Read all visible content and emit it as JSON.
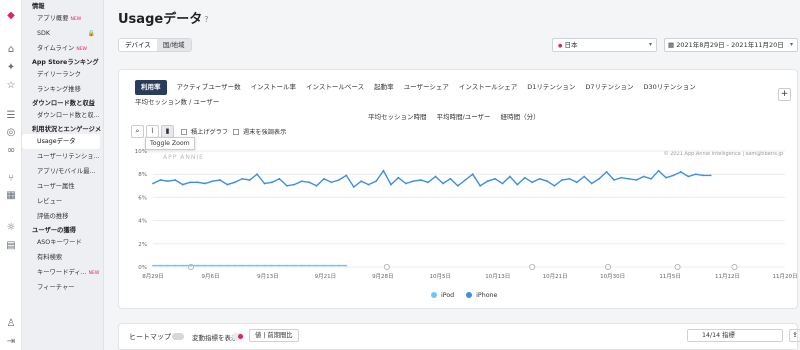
{
  "sidebar": {
    "groups": [
      {
        "heading": "情報",
        "items": [
          {
            "label": "アプリ概要",
            "badge": "NEW"
          },
          {
            "label": "SDK",
            "lock": "🔒"
          },
          {
            "label": "タイムライン",
            "badge": "NEW"
          }
        ]
      },
      {
        "heading": "App Storeランキング",
        "items": [
          {
            "label": "デイリーランク"
          },
          {
            "label": "ランキング推移"
          }
        ]
      },
      {
        "heading": "ダウンロード数と収益",
        "items": [
          {
            "label": "ダウンロード数と収..."
          }
        ]
      },
      {
        "heading": "利用状況とエンゲージメ",
        "items": [
          {
            "label": "Usageデータ",
            "active": true
          },
          {
            "label": "ユーザーリテンショ..."
          },
          {
            "label": "アプリ/モバイル最..."
          },
          {
            "label": "ユーザー属性"
          },
          {
            "label": "レビュー"
          },
          {
            "label": "評価の推移"
          }
        ]
      },
      {
        "heading": "ユーザーの獲得",
        "items": [
          {
            "label": "ASOキーワード"
          },
          {
            "label": "有料検索"
          },
          {
            "label": "キーワードディ...",
            "badge": "NEW"
          },
          {
            "label": "フィーチャー"
          }
        ]
      }
    ]
  },
  "page": {
    "title": "Usageデータ",
    "help": "?"
  },
  "toggle": {
    "device": "デバイス",
    "country": "国/地域"
  },
  "filters": {
    "country": "日本",
    "daterange": "2021年8月29日 - 2021年11月20日"
  },
  "tabs_row1": [
    "利用率",
    "アクティブユーザー数",
    "インストール率",
    "インストールベース",
    "起動率",
    "ユーザーシェア",
    "インストールシェア",
    "D1リテンション",
    "D7リテンション",
    "D30リテンション",
    "平均セッション数 / ユーザー"
  ],
  "tabs_row2": [
    "平均セッション時間",
    "平均時間/ユーザー",
    "経時間（分）"
  ],
  "toolbar": {
    "stack_label": "積上げグラフ",
    "weekend_label": "週末を強調表示",
    "tooltip": "Toggle Zoom",
    "plus": "+"
  },
  "chart_texts": {
    "watermark": "APP ANNIE",
    "copyright": "© 2021 App Annie Intelligence | sam@tiberis.jp"
  },
  "chart_data": {
    "type": "line",
    "x": [
      "8月29日",
      "8月30日",
      "8月31日",
      "9月1日",
      "9月2日",
      "9月3日",
      "9月4日",
      "9月5日",
      "9月6日",
      "9月7日",
      "9月8日",
      "9月9日",
      "9月10日",
      "9月11日",
      "9月12日",
      "9月13日",
      "9月14日",
      "9月15日",
      "9月16日",
      "9月17日",
      "9月18日",
      "9月19日",
      "9月20日",
      "9月21日",
      "9月22日",
      "9月23日",
      "9月24日",
      "9月25日",
      "9月26日",
      "9月27日",
      "9月28日",
      "9月29日",
      "9月30日",
      "10月1日",
      "10月2日",
      "10月3日",
      "10月4日",
      "10月5日",
      "10月6日",
      "10月7日",
      "10月8日",
      "10月9日",
      "10月10日",
      "10月11日",
      "10月12日",
      "10月13日",
      "10月14日",
      "10月15日",
      "10月16日",
      "10月17日",
      "10月18日",
      "10月19日",
      "10月20日",
      "10月21日",
      "10月22日",
      "10月23日",
      "10月24日",
      "10月25日",
      "10月26日",
      "10月27日",
      "10月28日",
      "10月29日",
      "10月30日",
      "10月31日",
      "11月1日",
      "11月2日",
      "11月3日",
      "11月4日",
      "11月5日",
      "11月6日",
      "11月7日",
      "11月8日",
      "11月9日",
      "11月10日",
      "11月11日",
      "11月12日"
    ],
    "xticks": [
      "8月29日",
      "9月6日",
      "9月13日",
      "9月21日",
      "9月28日",
      "10月5日",
      "10月13日",
      "10月21日",
      "10月30日",
      "11月5日",
      "11月12日",
      "11月20日"
    ],
    "yticks": [
      "0%",
      "2%",
      "4%",
      "6%",
      "8%",
      "10%"
    ],
    "ylim": [
      0,
      10
    ],
    "series": [
      {
        "name": "iPod",
        "color": "#6ec6ff",
        "values": [
          0.12,
          0.12,
          0.12,
          0.12,
          0.12,
          0.12,
          0.12,
          0.12,
          0.12,
          0.12,
          0.12,
          0.12,
          0.12,
          0.12,
          0.12,
          0.12,
          0.12,
          0.12,
          0.12,
          0.12,
          0.12,
          0.12,
          0.12,
          0.12,
          0.12,
          0.12,
          0.12
        ]
      },
      {
        "name": "iPhone",
        "color": "#3d8fe0",
        "values": [
          7.2,
          7.5,
          7.4,
          7.5,
          7.1,
          7.3,
          7.3,
          7.2,
          7.4,
          7.5,
          7.1,
          7.3,
          7.6,
          7.5,
          8.0,
          7.2,
          7.3,
          7.6,
          7.0,
          7.1,
          7.4,
          7.3,
          7.0,
          7.6,
          7.3,
          7.5,
          7.9,
          6.9,
          7.4,
          7.1,
          7.4,
          8.3,
          7.1,
          7.7,
          7.2,
          7.4,
          7.5,
          7.3,
          7.8,
          7.2,
          7.6,
          7.0,
          7.5,
          8.0,
          7.0,
          7.4,
          7.6,
          7.2,
          7.8,
          7.1,
          7.7,
          7.3,
          7.6,
          7.4,
          7.0,
          7.5,
          7.6,
          7.3,
          7.8,
          7.2,
          7.6,
          8.2,
          7.5,
          7.7,
          7.6,
          7.5,
          7.8,
          7.6,
          8.3,
          7.7,
          7.9,
          8.2,
          7.8,
          8.0,
          7.9,
          7.9
        ]
      }
    ]
  },
  "heatmap": {
    "label": "ヒートマップ",
    "change_label": "変動指標を表示",
    "period": "値 | 前期間比",
    "metrics": "14/14 指標",
    "export": "⇪"
  }
}
